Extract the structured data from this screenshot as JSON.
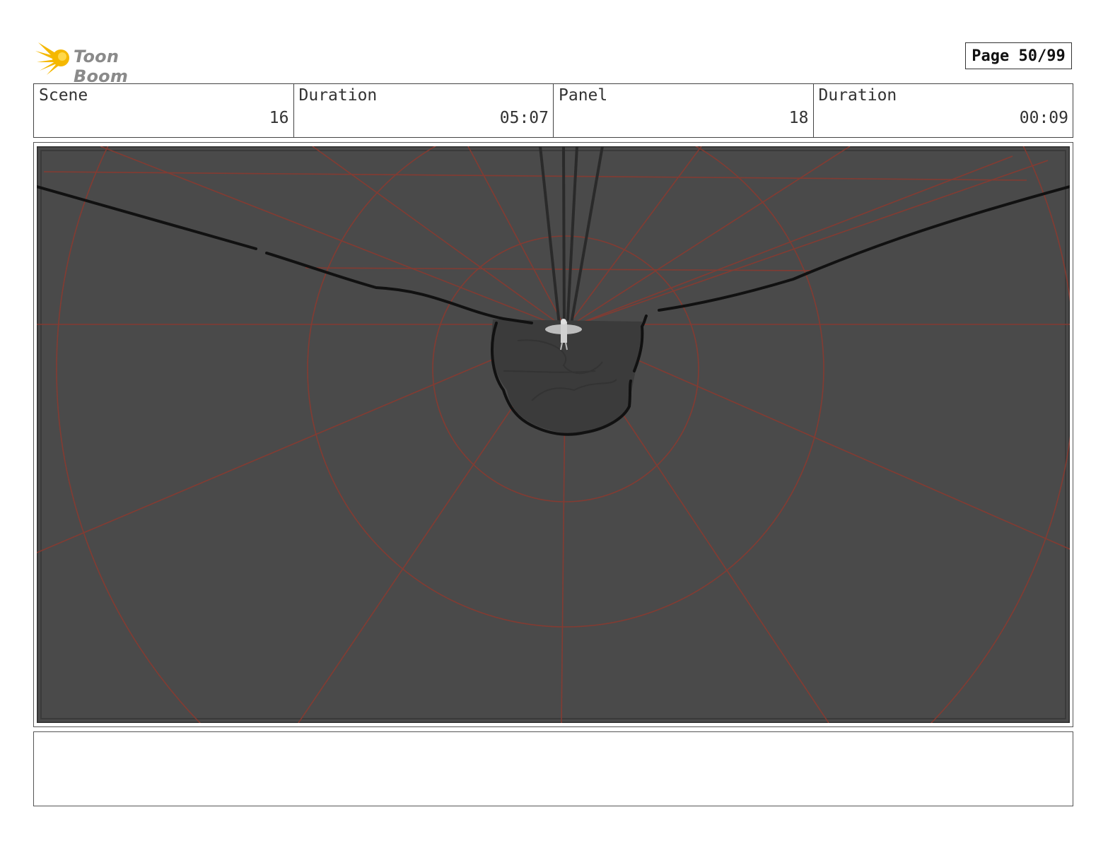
{
  "logo": {
    "text": "Toon Boom",
    "icon": "sun-burst-icon",
    "color": "#f5b800"
  },
  "page": {
    "label": "Page 50/99"
  },
  "info": {
    "scene_label": "Scene",
    "scene_value": "16",
    "scene_duration_label": "Duration",
    "scene_duration_value": "05:07",
    "panel_label": "Panel",
    "panel_value": "18",
    "panel_duration_label": "Duration",
    "panel_duration_value": "00:09"
  },
  "panel_image": {
    "background": "#4a4a4a",
    "guide_color": "#8a3a30"
  },
  "notes": {
    "text": ""
  }
}
